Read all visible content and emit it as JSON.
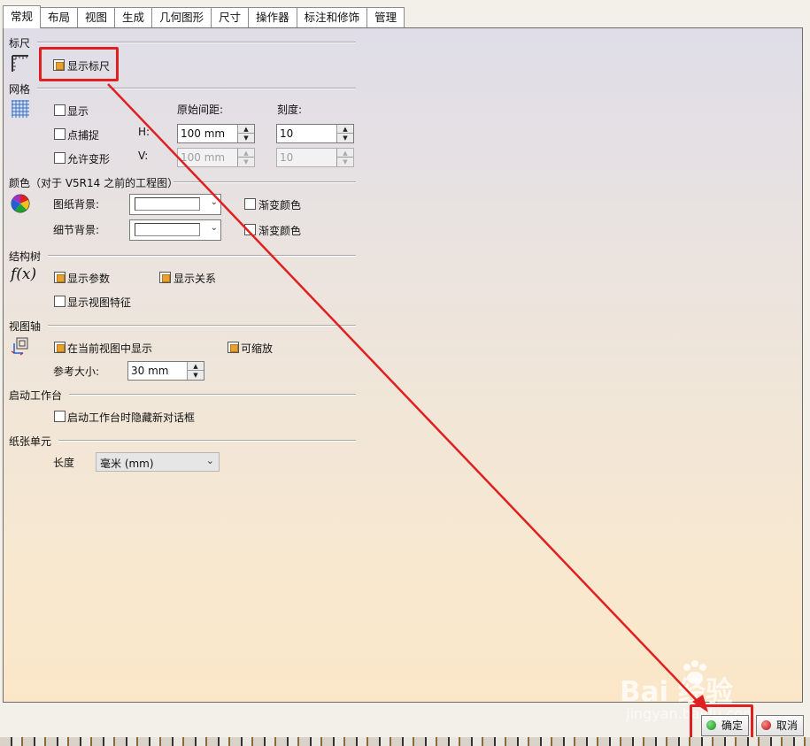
{
  "tabs": [
    {
      "label": "常规",
      "active": true
    },
    {
      "label": "布局"
    },
    {
      "label": "视图"
    },
    {
      "label": "生成"
    },
    {
      "label": "几何图形"
    },
    {
      "label": "尺寸"
    },
    {
      "label": "操作器"
    },
    {
      "label": "标注和修饰"
    },
    {
      "label": "管理"
    }
  ],
  "ruler": {
    "title": "标尺",
    "show_ruler": {
      "label": "显示标尺",
      "checked": true
    }
  },
  "grid": {
    "title": "网格",
    "show": {
      "label": "显示",
      "checked": false
    },
    "snap": {
      "label": "点捕捉",
      "checked": false
    },
    "distortion": {
      "label": "允许变形",
      "checked": false
    },
    "spacing_label": "原始间距:",
    "graduation_label": "刻度:",
    "h_label": "H:",
    "v_label": "V:",
    "h_spacing": "100 mm",
    "h_graduation": "10",
    "v_spacing": "100 mm",
    "v_graduation": "10"
  },
  "colors": {
    "title": "颜色（对于 V5R14 之前的工程图）",
    "sheet_bg_label": "图纸背景:",
    "detail_bg_label": "细节背景:",
    "gradient1": {
      "label": "渐变颜色",
      "checked": false
    },
    "gradient2": {
      "label": "渐变颜色",
      "checked": false
    }
  },
  "tree": {
    "title": "结构树",
    "show_params": {
      "label": "显示参数",
      "checked": true
    },
    "show_relations": {
      "label": "显示关系",
      "checked": true
    },
    "show_view_features": {
      "label": "显示视图特征",
      "checked": false
    }
  },
  "view_axis": {
    "title": "视图轴",
    "display_in_current": {
      "label": "在当前视图中显示",
      "checked": true
    },
    "zoomable": {
      "label": "可缩放",
      "checked": true
    },
    "ref_size_label": "参考大小:",
    "ref_size": "30 mm"
  },
  "workbench": {
    "title": "启动工作台",
    "hide_dialog": {
      "label": "启动工作台时隐藏新对话框",
      "checked": false
    }
  },
  "paper_units": {
    "title": "纸张单元",
    "length_label": "长度",
    "length_value": "毫米 (mm)"
  },
  "buttons": {
    "ok": "确定",
    "cancel": "取消"
  },
  "watermark": {
    "brand": "Bai  经验",
    "url": "jingyan.baidu.com"
  },
  "colors_theme": {
    "annotation_red": "#e02020",
    "check_orange": "#e8a02e",
    "ok_green": "#2aa52a",
    "cancel_red": "#d42020"
  }
}
